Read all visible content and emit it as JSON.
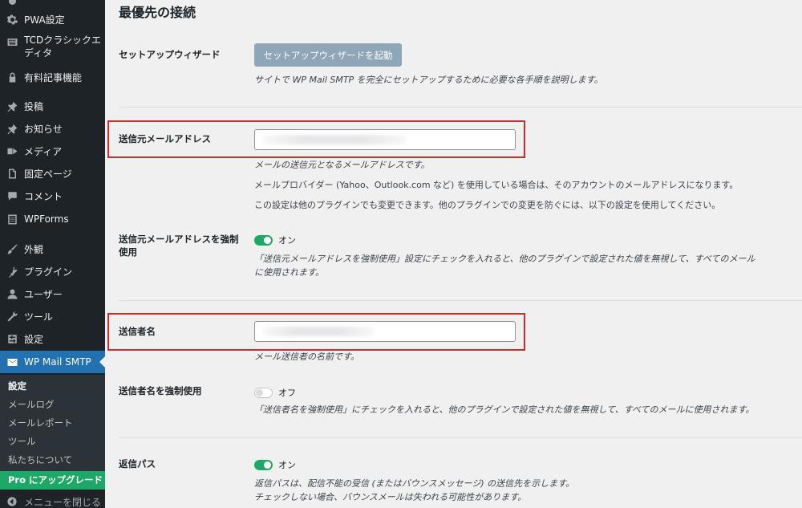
{
  "sidebar": {
    "items": [
      {
        "label": "PWA設定",
        "icon": "gear-icon"
      },
      {
        "label": "TCDクラシックエディタ",
        "icon": "keyboard-icon"
      },
      {
        "label": "有料記事機能",
        "icon": "lock-icon"
      },
      {
        "label": "投稿",
        "icon": "pin-icon"
      },
      {
        "label": "お知らせ",
        "icon": "pin-icon"
      },
      {
        "label": "メディア",
        "icon": "media-icon"
      },
      {
        "label": "固定ページ",
        "icon": "page-icon"
      },
      {
        "label": "コメント",
        "icon": "comment-icon"
      },
      {
        "label": "WPForms",
        "icon": "form-icon"
      },
      {
        "label": "外観",
        "icon": "brush-icon"
      },
      {
        "label": "プラグイン",
        "icon": "plugin-icon"
      },
      {
        "label": "ユーザー",
        "icon": "user-icon"
      },
      {
        "label": "ツール",
        "icon": "wrench-icon"
      },
      {
        "label": "設定",
        "icon": "settings-icon"
      },
      {
        "label": "WP Mail SMTP",
        "icon": "mail-icon"
      }
    ],
    "submenu": [
      "設定",
      "メールログ",
      "メールレポート",
      "ツール",
      "私たちについて"
    ],
    "pro_upgrade": "Pro にアップグレード",
    "collapse": "メニューを閉じる"
  },
  "main": {
    "section_title": "最優先の接続",
    "wizard": {
      "label": "セットアップウィザード",
      "button": "セットアップウィザードを起動",
      "desc": "サイトで WP Mail SMTP を完全にセットアップするために必要な各手順を説明します。"
    },
    "from_email": {
      "label": "送信元メールアドレス",
      "value": "",
      "desc1": "メールの送信元となるメールアドレスです。",
      "desc2": "メールプロバイダー (Yahoo、Outlook.com など) を使用している場合は、そのアカウントのメールアドレスになります。",
      "desc3": "この設定は他のプラグインでも変更できます。他のプラグインでの変更を防ぐには、以下の設定を使用してください。"
    },
    "force_email": {
      "label1": "送信元メールアドレスを強制",
      "label2": "使用",
      "state": "オン",
      "desc1": "「送信元メールアドレスを強制使用」設定にチェックを入れると、他のプラグインで設定された値を無視して、すべてのメール",
      "desc2": "に使用されます。"
    },
    "from_name": {
      "label": "送信者名",
      "value": "",
      "desc": "メール送信者の名前です。"
    },
    "force_name": {
      "label": "送信者名を強制使用",
      "state": "オフ",
      "desc": "「送信者名を強制使用」にチェックを入れると、他のプラグインで設定された値を無視して、すべてのメールに使用されます。"
    },
    "return_path": {
      "label": "返信パス",
      "state": "オン",
      "desc1": "返信パスは、配信不能の受信 (またはバウンスメッセージ) の送信先を示します。",
      "desc2": "チェックしない場合、バウンスメールは失われる可能性があります。"
    }
  },
  "colors": {
    "sidebar_bg": "#1d2327",
    "current_menu": "#2271b1",
    "toggle_on": "#1da867",
    "highlight": "#d02c2c"
  }
}
